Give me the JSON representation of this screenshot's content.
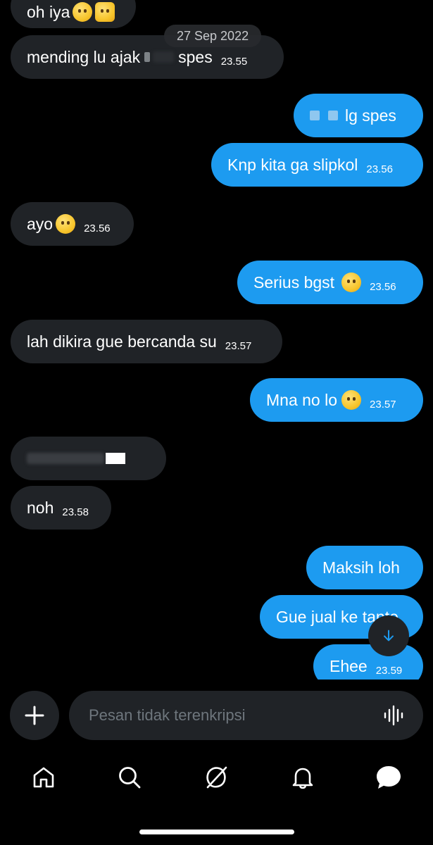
{
  "chat": {
    "date_divider": "27 Sep 2022",
    "messages": [
      {
        "id": "m0",
        "text": "oh iya",
        "time": ""
      },
      {
        "id": "m1",
        "text_before": "mending lu ajak",
        "text_after": "spes",
        "time": "23.55"
      },
      {
        "id": "m2",
        "text": "lg spes",
        "time": ""
      },
      {
        "id": "m3",
        "text": "Knp kita ga slipkol",
        "time": "23.56"
      },
      {
        "id": "m4",
        "text": "ayo",
        "time": "23.56"
      },
      {
        "id": "m5",
        "text": "Serius bgst",
        "time": "23.56"
      },
      {
        "id": "m6",
        "text": "lah dikira gue bercanda su",
        "time": "23.57"
      },
      {
        "id": "m7",
        "text": "Mna no lo",
        "time": "23.57"
      },
      {
        "id": "m8",
        "text": "",
        "time": ""
      },
      {
        "id": "m9",
        "text": "noh",
        "time": "23.58"
      },
      {
        "id": "m10",
        "text": "Maksih loh",
        "time": ""
      },
      {
        "id": "m11",
        "text": "Gue jual ke tante",
        "time": ""
      },
      {
        "id": "m12",
        "text": "Ehee",
        "time": "23.59"
      }
    ]
  },
  "composer": {
    "placeholder": "Pesan tidak terenkripsi"
  },
  "nav": {
    "items": [
      "home-icon",
      "search-icon",
      "grok-icon",
      "notifications-icon",
      "messages-icon"
    ]
  },
  "colors": {
    "background": "#000000",
    "incoming_bubble": "#202327",
    "outgoing_bubble": "#1d9bf0",
    "placeholder": "#6e767d",
    "accent": "#1d9bf0"
  }
}
